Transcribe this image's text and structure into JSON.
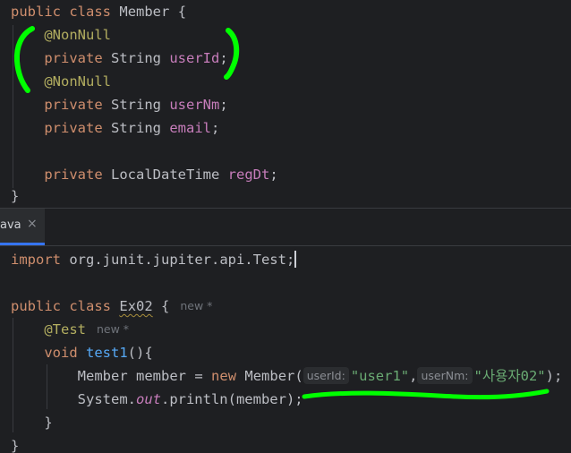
{
  "top_editor": {
    "line1": {
      "kw1": "public",
      "kw2": "class",
      "class_name": "Member",
      "brace": "{"
    },
    "line2": {
      "annotation": "@NonNull"
    },
    "line3": {
      "kw": "private",
      "type": "String",
      "field": "userId",
      "semi": ";"
    },
    "line4": {
      "annotation": "@NonNull"
    },
    "line5": {
      "kw": "private",
      "type": "String",
      "field": "userNm",
      "semi": ";"
    },
    "line6": {
      "kw": "private",
      "type": "String",
      "field": "email",
      "semi": ";"
    },
    "line8": {
      "kw": "private",
      "type": "LocalDateTime",
      "field": "regDt",
      "semi": ";"
    },
    "line9": {
      "brace": "}"
    }
  },
  "tab": {
    "label": "ava",
    "close_glyph": "×"
  },
  "bottom_editor": {
    "line1": {
      "kw": "import",
      "path": "org.junit.jupiter.api.Test",
      "semi": ";"
    },
    "line3": {
      "kw1": "public",
      "kw2": "class",
      "class_name": "Ex02",
      "brace": "{",
      "author": "new *"
    },
    "line4": {
      "annotation": "@Test",
      "author": "new *"
    },
    "line5": {
      "kw": "void",
      "method": "test1",
      "rest": "(){"
    },
    "line6": {
      "type": "Member",
      "var": "member",
      "assign": "=",
      "kw": "new",
      "ctor": "Member(",
      "hint1": "userId:",
      "arg1": "\"user1\"",
      "comma": ",",
      "hint2": "userNm:",
      "arg2": "\"사용자02\"",
      "end": ");"
    },
    "line7": {
      "obj": "System.",
      "field": "out",
      "call": ".println(member);"
    },
    "line8": {
      "brace": "}"
    },
    "line9": {
      "brace": "}"
    }
  },
  "markup_colors": {
    "highlight": "#00ff00"
  }
}
